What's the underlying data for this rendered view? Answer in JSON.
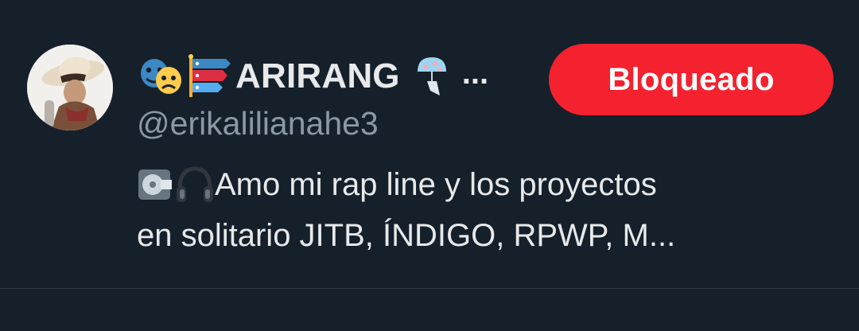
{
  "profile": {
    "display_name": "ARIRANG",
    "name_emojis_before": [
      "performing-arts-icon",
      "carp-streamer-icon"
    ],
    "name_emojis_after": [
      "wind-chime-icon"
    ],
    "name_truncation": "...",
    "handle": "@erikalilianahe3",
    "bio_line1_text": "Amo mi rap line y los proyectos",
    "bio_line1_emojis": [
      "minidisc-icon",
      "headphone-icon"
    ],
    "bio_line2_text": "en solitario JITB, ÍNDIGO, RPWP, M..."
  },
  "actions": {
    "blocked_label": "Bloqueado"
  },
  "colors": {
    "background": "#15202b",
    "primary_text": "#e7e9ea",
    "secondary_text": "#8b98a5",
    "blocked_button": "#f4212e"
  }
}
